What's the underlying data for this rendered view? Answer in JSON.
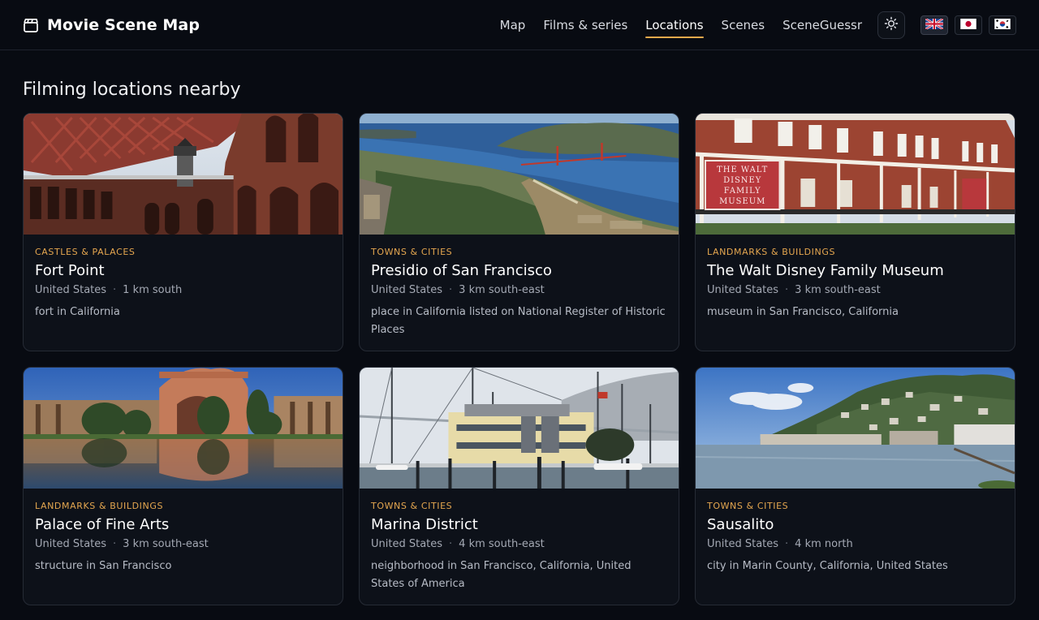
{
  "app": {
    "title": "Movie Scene Map"
  },
  "nav": {
    "items": [
      {
        "label": "Map"
      },
      {
        "label": "Films & series"
      },
      {
        "label": "Locations",
        "active": true
      },
      {
        "label": "Scenes"
      },
      {
        "label": "SceneGuessr"
      }
    ]
  },
  "icons": {
    "brand": "clapperboard-icon",
    "theme": "sun-icon",
    "flags": [
      "uk-flag-icon",
      "japan-flag-icon",
      "korea-flag-icon"
    ]
  },
  "colors": {
    "accent": "#e5a84c",
    "background": "#080b12",
    "card": "#0d1119"
  },
  "section": {
    "title": "Filming locations nearby"
  },
  "locations": [
    {
      "category": "CASTLES & PALACES",
      "name": "Fort Point",
      "country": "United States",
      "distance": "1 km south",
      "description": "fort in California"
    },
    {
      "category": "TOWNS & CITIES",
      "name": "Presidio of San Francisco",
      "country": "United States",
      "distance": "3 km south-east",
      "description": "place in California listed on National Register of Historic Places"
    },
    {
      "category": "LANDMARKS & BUILDINGS",
      "name": "The Walt Disney Family Museum",
      "country": "United States",
      "distance": "3 km south-east",
      "description": "museum in San Francisco, California",
      "sign_text": "THE WALT DISNEY FAMILY MUSEUM"
    },
    {
      "category": "LANDMARKS & BUILDINGS",
      "name": "Palace of Fine Arts",
      "country": "United States",
      "distance": "3 km south-east",
      "description": "structure in San Francisco"
    },
    {
      "category": "TOWNS & CITIES",
      "name": "Marina District",
      "country": "United States",
      "distance": "4 km south-east",
      "description": "neighborhood in San Francisco, California, United States of America"
    },
    {
      "category": "TOWNS & CITIES",
      "name": "Sausalito",
      "country": "United States",
      "distance": "4 km north",
      "description": "city in Marin County, California, United States"
    }
  ]
}
